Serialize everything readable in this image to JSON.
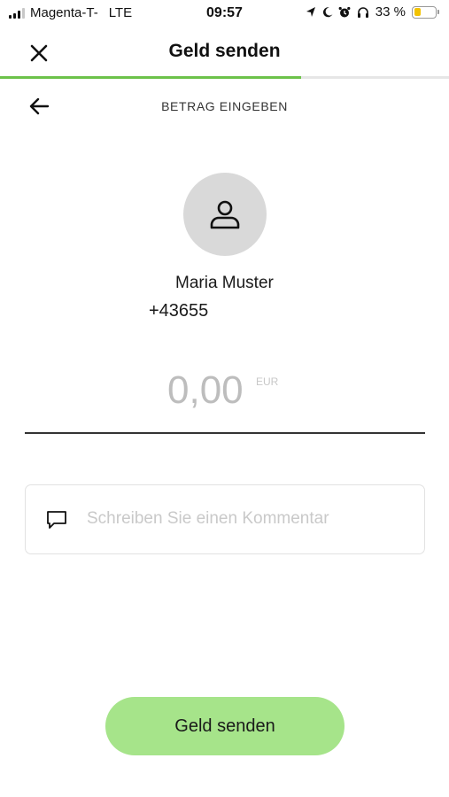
{
  "status_bar": {
    "carrier": "Magenta-T-",
    "network": "LTE",
    "time": "09:57",
    "battery_percent_label": "33 %",
    "battery_level": 0.33,
    "battery_color": "#f2c200",
    "icons": [
      "signal-icon",
      "location-icon",
      "moon-icon",
      "alarm-icon",
      "headphones-icon",
      "battery-icon"
    ]
  },
  "header": {
    "title": "Geld senden",
    "close_icon": "close-icon",
    "progress": 0.67,
    "progress_color": "#6cc24a"
  },
  "step": {
    "title": "BETRAG EINGEBEN",
    "back_icon": "arrow-left-icon"
  },
  "recipient": {
    "avatar_icon": "person-icon",
    "name": "Maria Muster",
    "phone": "+43655"
  },
  "amount": {
    "value": "0,00",
    "currency": "EUR"
  },
  "comment": {
    "icon": "comment-icon",
    "placeholder": "Schreiben Sie einen Kommentar",
    "value": ""
  },
  "actions": {
    "send_label": "Geld senden",
    "send_color": "#a6e48a"
  }
}
